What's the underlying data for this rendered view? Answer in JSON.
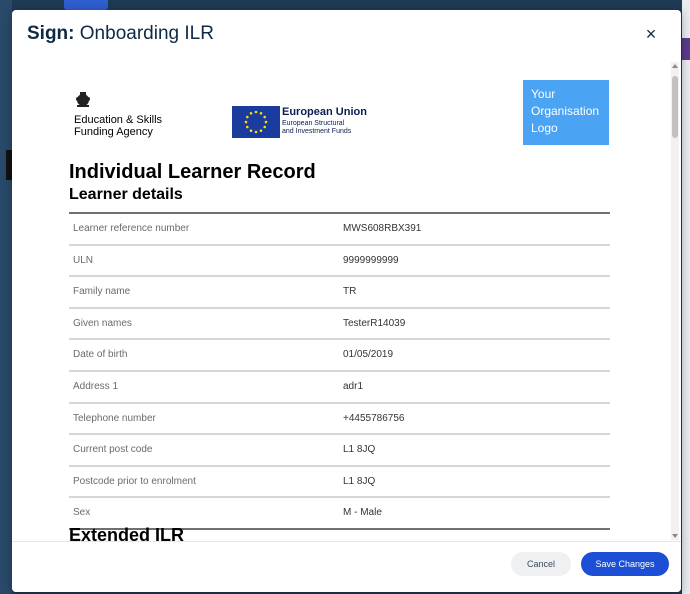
{
  "modal": {
    "title_prefix": "Sign:",
    "title": "Onboarding ILR",
    "close_glyph": "×"
  },
  "logos": {
    "esfa_line1": "Education & Skills",
    "esfa_line2": "Funding Agency",
    "eu_title": "European Union",
    "eu_sub1": "European Structural",
    "eu_sub2": "and Investment Funds",
    "org_line1": "Your",
    "org_line2": "Organisation",
    "org_line3": "Logo"
  },
  "document": {
    "heading": "Individual Learner Record",
    "section": "Learner details",
    "next_section": "Extended ILR",
    "rows": [
      {
        "label": "Learner reference number",
        "value": "MWS608RBX391"
      },
      {
        "label": "ULN",
        "value": "9999999999"
      },
      {
        "label": "Family name",
        "value": "TR"
      },
      {
        "label": "Given names",
        "value": "TesterR14039"
      },
      {
        "label": "Date of birth",
        "value": "01/05/2019"
      },
      {
        "label": "Address 1",
        "value": "adr1"
      },
      {
        "label": "Telephone number",
        "value": "+4455786756"
      },
      {
        "label": "Current post code",
        "value": "L1 8JQ"
      },
      {
        "label": "Postcode prior to enrolment",
        "value": "L1 8JQ"
      },
      {
        "label": "Sex",
        "value": "M - Male"
      }
    ]
  },
  "footer": {
    "cancel_label": "Cancel",
    "save_label": "Save Changes"
  },
  "colors": {
    "primary": "#1d4fd6",
    "org_logo_bg": "#4aa3f3",
    "eu_flag": "#1a3c9e",
    "eu_stars": "#ffdd00"
  }
}
